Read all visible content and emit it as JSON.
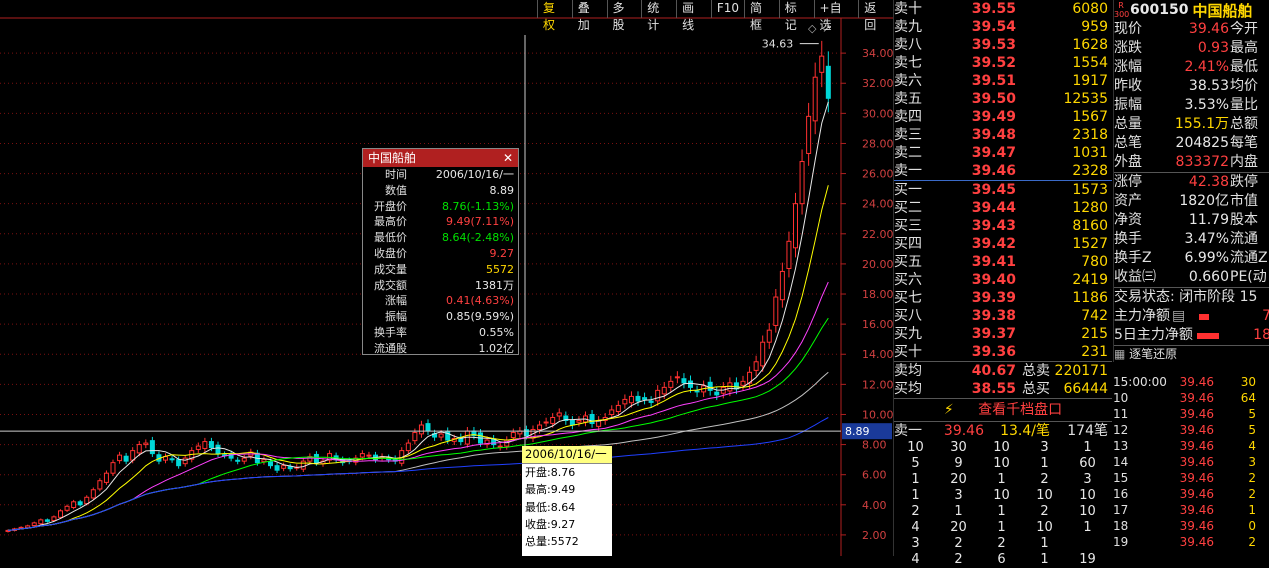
{
  "toolbar": [
    "复权",
    "叠加",
    "多股",
    "统计",
    "画线",
    "F10",
    "简框",
    "标记",
    "+自选",
    "返回"
  ],
  "chart_data": {
    "type": "candlestick",
    "y_ticks": [
      2.0,
      4.0,
      6.0,
      8.0,
      10.0,
      12.0,
      14.0,
      16.0,
      18.0,
      20.0,
      22.0,
      24.0,
      26.0,
      28.0,
      30.0,
      32.0,
      34.0
    ],
    "ylim": [
      0.6,
      36.2
    ],
    "high_label": "34.63",
    "crosshair_price": "8.89",
    "closes": [
      2.3,
      2.4,
      2.5,
      2.6,
      2.8,
      3.0,
      2.9,
      3.2,
      3.6,
      3.9,
      4.2,
      4.0,
      4.5,
      5.0,
      5.6,
      6.1,
      6.8,
      7.3,
      6.9,
      7.6,
      8.0,
      8.1,
      7.4,
      6.9,
      7.2,
      7.0,
      6.6,
      7.1,
      7.6,
      7.9,
      8.2,
      7.8,
      7.4,
      7.3,
      7.1,
      6.9,
      7.1,
      7.5,
      6.8,
      7.0,
      6.6,
      6.3,
      6.6,
      6.4,
      6.5,
      6.9,
      7.2,
      6.8,
      6.9,
      7.4,
      7.0,
      6.8,
      6.9,
      7.1,
      7.4,
      7.3,
      7.0,
      7.2,
      7.0,
      6.9,
      7.6,
      8.1,
      8.8,
      9.3,
      8.9,
      8.5,
      8.7,
      8.3,
      8.4,
      8.2,
      8.9,
      8.6,
      8.1,
      8.3,
      8.0,
      7.9,
      8.3,
      8.8,
      8.9,
      8.6,
      9.0,
      9.3,
      9.5,
      9.8,
      10.1,
      9.6,
      9.3,
      9.6,
      9.9,
      9.4,
      9.6,
      9.8,
      10.3,
      10.6,
      11.0,
      11.2,
      10.9,
      11.0,
      10.8,
      11.6,
      11.8,
      12.2,
      12.5,
      12.1,
      11.8,
      11.5,
      11.9,
      11.6,
      11.3,
      11.8,
      12.1,
      11.7,
      12.2,
      12.8,
      13.5,
      14.8,
      15.6,
      17.8,
      19.5,
      21.5,
      24.0,
      26.8,
      29.8,
      32.4,
      33.8,
      31.0
    ]
  },
  "tooltip": {
    "title": "中国船舶",
    "rows": [
      {
        "k": "时间",
        "v": "2006/10/16/一",
        "c": "wht"
      },
      {
        "k": "数值",
        "v": "8.89",
        "c": "wht"
      },
      {
        "k": "开盘价",
        "v": "8.76(-1.13%)",
        "c": "grn"
      },
      {
        "k": "最高价",
        "v": "9.49(7.11%)",
        "c": "red"
      },
      {
        "k": "最低价",
        "v": "8.64(-2.48%)",
        "c": "grn"
      },
      {
        "k": "收盘价",
        "v": "9.27",
        "c": "red"
      },
      {
        "k": "成交量",
        "v": "5572",
        "c": "yel"
      },
      {
        "k": "成交额",
        "v": "1381万",
        "c": "wht"
      },
      {
        "k": "涨幅",
        "v": "0.41(4.63%)",
        "c": "red"
      },
      {
        "k": "振幅",
        "v": "0.85(9.59%)",
        "c": "wht"
      },
      {
        "k": "换手率",
        "v": "0.55%",
        "c": "wht"
      },
      {
        "k": "流通股",
        "v": "1.02亿",
        "c": "wht"
      }
    ]
  },
  "bottom_box": {
    "date": "2006/10/16/一",
    "rows": [
      "开盘:8.76",
      "最高:9.49",
      "最低:8.64",
      "收盘:9.27",
      "总量:5572"
    ]
  },
  "orderbook": {
    "sells": [
      [
        "卖十",
        "39.55",
        "6080"
      ],
      [
        "卖九",
        "39.54",
        "959"
      ],
      [
        "卖八",
        "39.53",
        "1628"
      ],
      [
        "卖七",
        "39.52",
        "1554"
      ],
      [
        "卖六",
        "39.51",
        "1917"
      ],
      [
        "卖五",
        "39.50",
        "12535"
      ],
      [
        "卖四",
        "39.49",
        "1567"
      ],
      [
        "卖三",
        "39.48",
        "2318"
      ],
      [
        "卖二",
        "39.47",
        "1031"
      ],
      [
        "卖一",
        "39.46",
        "2328"
      ]
    ],
    "buys": [
      [
        "买一",
        "39.45",
        "1573"
      ],
      [
        "买二",
        "39.44",
        "1280"
      ],
      [
        "买三",
        "39.43",
        "8160"
      ],
      [
        "买四",
        "39.42",
        "1527"
      ],
      [
        "买五",
        "39.41",
        "780"
      ],
      [
        "买六",
        "39.40",
        "2419"
      ],
      [
        "买七",
        "39.39",
        "1186"
      ],
      [
        "买八",
        "39.38",
        "742"
      ],
      [
        "买九",
        "39.37",
        "215"
      ],
      [
        "买十",
        "39.36",
        "231"
      ]
    ],
    "avg_sell": [
      "卖均",
      "40.67",
      "总卖",
      "220171"
    ],
    "avg_buy": [
      "买均",
      "38.55",
      "总买",
      "66444"
    ],
    "view_button": "查看千档盘口",
    "sell1_detail": [
      "卖一",
      "39.46",
      "13.4/笔",
      "174笔"
    ],
    "grid": [
      [
        "10",
        "30",
        "10",
        "3",
        "1"
      ],
      [
        "5",
        "9",
        "10",
        "1",
        "60"
      ],
      [
        "1",
        "20",
        "1",
        "2",
        "3"
      ],
      [
        "1",
        "3",
        "10",
        "10",
        "10"
      ],
      [
        "2",
        "1",
        "1",
        "2",
        "10"
      ],
      [
        "4",
        "20",
        "1",
        "10",
        "1"
      ],
      [
        "3",
        "2",
        "2",
        "1",
        ""
      ],
      [
        "4",
        "2",
        "6",
        "1",
        "19"
      ]
    ]
  },
  "info": {
    "code": "600150",
    "name": "中国船舶",
    "tag_top": "R",
    "tag_bottom": "300",
    "rows": [
      {
        "k": "现价",
        "v": "39.46",
        "c": "red",
        "k2": "今开"
      },
      {
        "k": "涨跌",
        "v": "0.93",
        "c": "red",
        "k2": "最高"
      },
      {
        "k": "涨幅",
        "v": "2.41%",
        "c": "red",
        "k2": "最低"
      },
      {
        "k": "昨收",
        "v": "38.53",
        "c": "wht",
        "k2": "均价"
      },
      {
        "k": "振幅",
        "v": "3.53%",
        "c": "wht",
        "k2": "量比"
      },
      {
        "k": "总量",
        "v": "155.1万",
        "c": "yel",
        "k2": "总额"
      },
      {
        "k": "总笔",
        "v": "204825",
        "c": "wht",
        "k2": "每笔"
      },
      {
        "k": "外盘",
        "v": "833372",
        "c": "red",
        "k2": "内盘"
      },
      {
        "k": "涨停",
        "v": "42.38",
        "c": "red",
        "k2": "跌停"
      },
      {
        "k": "资产",
        "v": "1820亿",
        "c": "wht",
        "k2": "市值"
      },
      {
        "k": "净资",
        "v": "11.79",
        "c": "wht",
        "k2": "股本"
      },
      {
        "k": "换手",
        "v": "3.47%",
        "c": "wht",
        "k2": "流通"
      },
      {
        "k": "换手Z",
        "v": "6.99%",
        "c": "wht",
        "k2": "流通Z"
      },
      {
        "k": "收益㈢",
        "v": "0.660",
        "c": "wht",
        "k2": "PE(动"
      }
    ],
    "trade_state": "交易状态: 闭市阶段 15",
    "main_flow": [
      "主力净额",
      "7"
    ],
    "main_flow5": [
      "5日主力净额",
      "18"
    ],
    "tick_title": "逐笔还原",
    "ticks": [
      [
        "15:00:00",
        "39.46",
        "30"
      ],
      [
        "10",
        "39.46",
        "64"
      ],
      [
        "11",
        "39.46",
        "5"
      ],
      [
        "12",
        "39.46",
        "5"
      ],
      [
        "13",
        "39.46",
        "4"
      ],
      [
        "14",
        "39.46",
        "3"
      ],
      [
        "15",
        "39.46",
        "2"
      ],
      [
        "16",
        "39.46",
        "2"
      ],
      [
        "17",
        "39.46",
        "1"
      ],
      [
        "18",
        "39.46",
        "0"
      ],
      [
        "19",
        "39.46",
        "2"
      ]
    ]
  }
}
